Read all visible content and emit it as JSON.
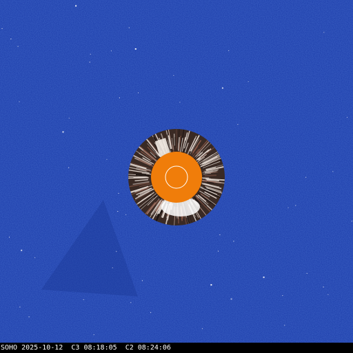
{
  "image": {
    "observatory": "SOHO",
    "date": "2025-10-12",
    "c3_label": "C3",
    "c3_time": "08:18:05",
    "c2_label": "C2",
    "c2_time": "08:24:06"
  },
  "colors": {
    "c3_background": "#1a3aa8",
    "c2_ring_dark": "#3a2a24",
    "c2_ring_light": "#e8ddd5",
    "occulter_disk": "#f07d0a",
    "sun_circle": "#ffffff",
    "caption_bar": "#000000",
    "caption_text": "#ffffff"
  }
}
